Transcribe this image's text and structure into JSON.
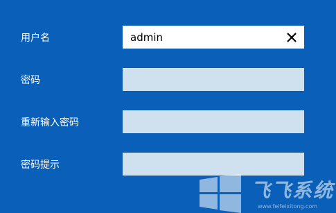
{
  "form": {
    "username": {
      "label": "用户名",
      "value": "admin"
    },
    "password": {
      "label": "密码",
      "value": ""
    },
    "confirm_password": {
      "label": "重新输入密码",
      "value": ""
    },
    "password_hint": {
      "label": "密码提示",
      "value": ""
    }
  },
  "icons": {
    "clear": "close-icon"
  },
  "watermark": {
    "name": "飞飞系统",
    "url": "www.feifeixitong.com"
  },
  "colors": {
    "background": "#0a5fb8",
    "field": "#cfe0ef",
    "active_field": "#ffffff"
  }
}
